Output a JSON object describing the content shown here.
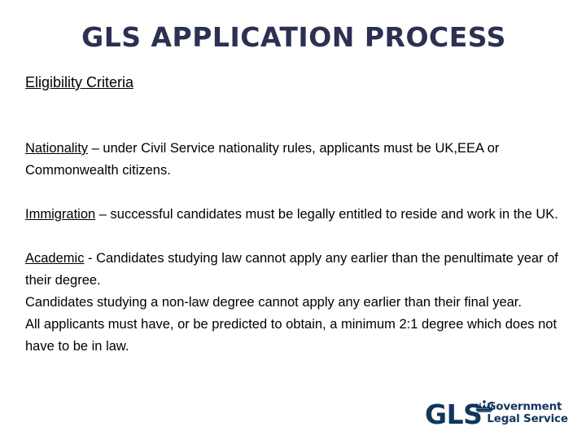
{
  "slide": {
    "title": "GLS APPLICATION PROCESS",
    "heading": "Eligibility Criteria",
    "sections": [
      {
        "term": "Nationality",
        "body": " – under Civil Service nationality rules, applicants must be UK,EEA or Commonwealth citizens."
      },
      {
        "term": "Immigration",
        "body": " – successful candidates must be legally entitled to reside and work in the UK."
      },
      {
        "term": "Academic",
        "body": " - Candidates studying law cannot apply any earlier than the penultimate year of their degree."
      }
    ],
    "academic_extra": [
      "Candidates studying a non-law degree cannot apply any earlier than their final year.",
      "All applicants must have, or be predicted to obtain, a minimum 2:1 degree which does not have to be in law."
    ]
  },
  "logo": {
    "acronym": "GLS",
    "line1": "Government",
    "line2": "Legal Service",
    "crown_icon": "crown-icon",
    "color": "#12375e"
  },
  "colors": {
    "title": "#2c3052",
    "body": "#000000",
    "background": "#ffffff",
    "logo_navy": "#12375e"
  }
}
